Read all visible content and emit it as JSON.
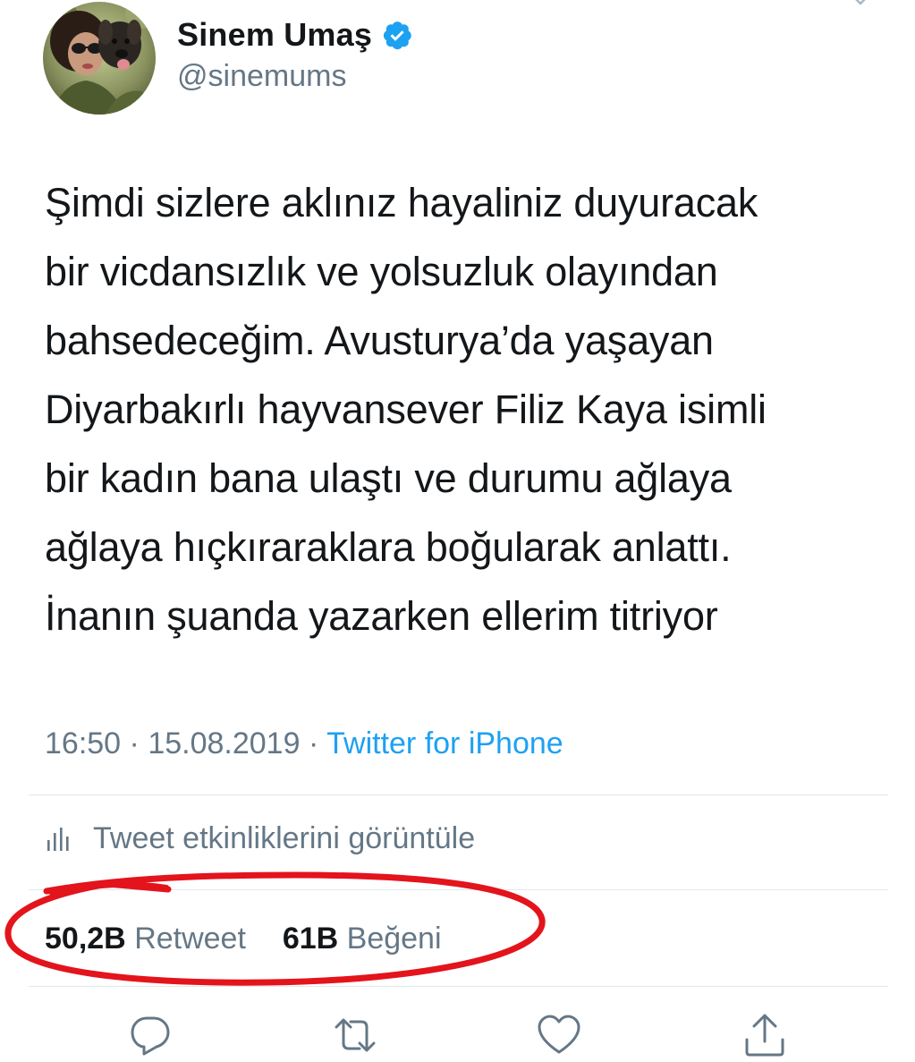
{
  "author": {
    "display_name": "Sinem Umaş",
    "handle": "@sinemums",
    "verified": true,
    "avatar_icon": "profile-photo-avatar"
  },
  "tweet": {
    "text": "Şimdi sizlere aklınız hayaliniz duyuracak\nbir vicdansızlık ve yolsuzluk olayından\nbahsedeceğim. Avusturya’da yaşayan\nDiyarbakırlı hayvansever Filiz Kaya isimli\nbir kadın bana ulaştı ve durumu ağlaya\nağlaya hıçkıraraklara boğularak anlattı.\nİnanın şuanda yazarken ellerim titriyor"
  },
  "meta": {
    "time": "16:50",
    "separator": "·",
    "date": "15.08.2019",
    "source": "Twitter for iPhone"
  },
  "activity": {
    "label": "Tweet etkinliklerini görüntüle",
    "icon": "analytics-bars-icon"
  },
  "stats": {
    "retweets_count": "50,2B",
    "retweets_label": "Retweet",
    "likes_count": "61B",
    "likes_label": "Beğeni"
  },
  "actions": [
    {
      "icon": "reply-icon"
    },
    {
      "icon": "retweet-icon"
    },
    {
      "icon": "like-heart-icon"
    },
    {
      "icon": "share-icon"
    }
  ],
  "colors": {
    "text": "#14171a",
    "secondary": "#657786",
    "link": "#1da1f2",
    "divider": "#e1e8ed",
    "annotation": "#e3141c"
  }
}
